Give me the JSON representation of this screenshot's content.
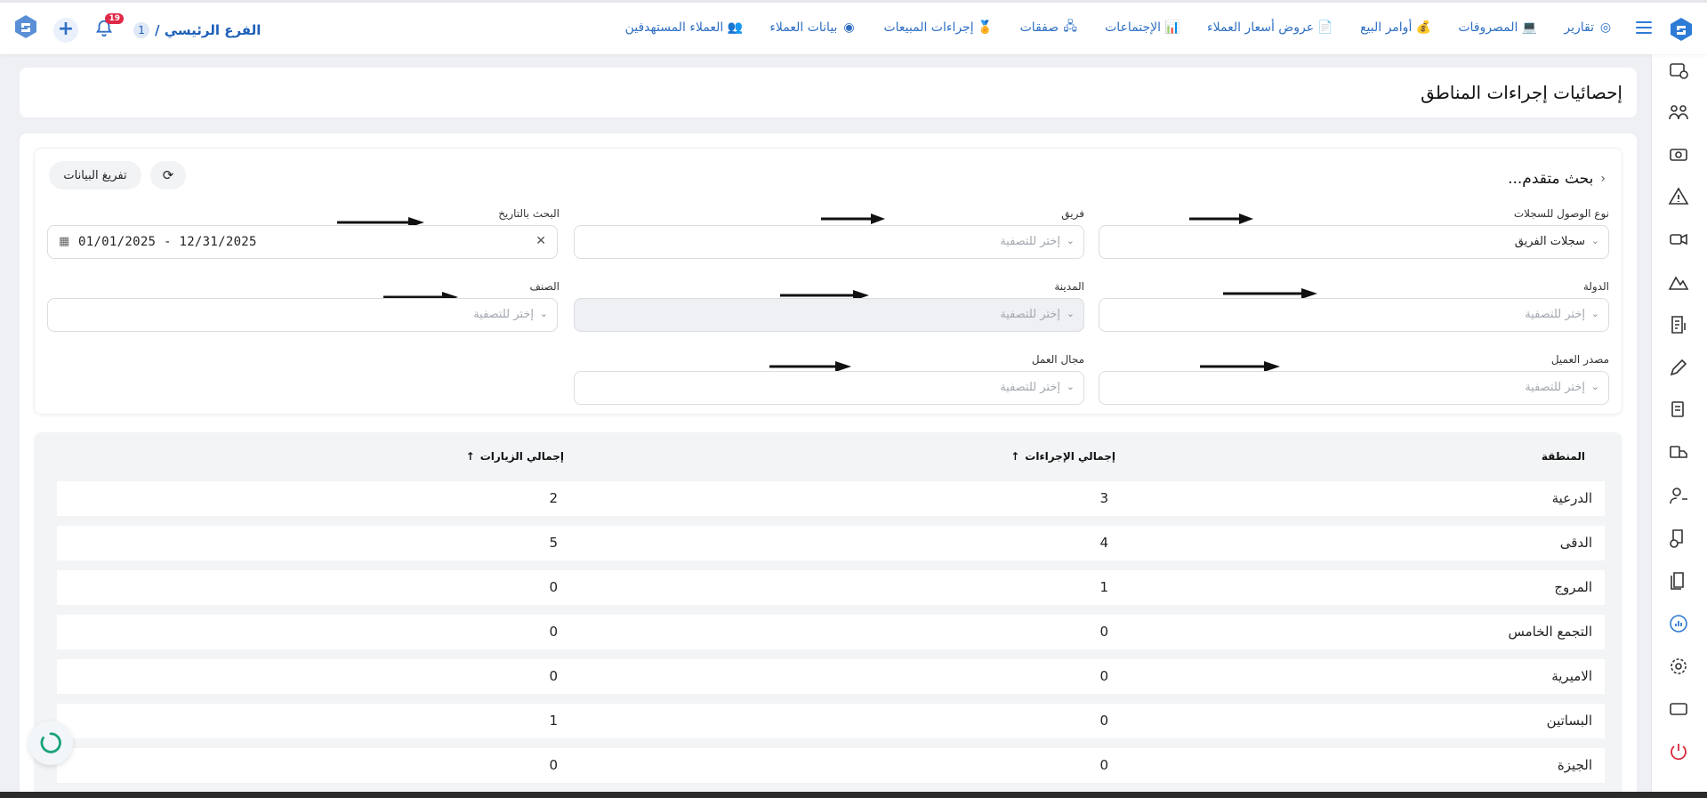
{
  "nav": {
    "items": [
      {
        "label": "العملاء المستهدفين",
        "icon": "target-users-icon"
      },
      {
        "label": "بيانات العملاء",
        "icon": "webcam-icon"
      },
      {
        "label": "إجراءات المبيعات",
        "icon": "award-icon"
      },
      {
        "label": "صفقات",
        "icon": "network-icon"
      },
      {
        "label": "الإجتماعات",
        "icon": "presentation-icon"
      },
      {
        "label": "عروض أسعار العملاء",
        "icon": "document-icon"
      },
      {
        "label": "أوامر البيع",
        "icon": "money-bag-icon"
      },
      {
        "label": "المصروفات",
        "icon": "laptop-icon"
      },
      {
        "label": "تقارير",
        "icon": "chart-ring-icon"
      }
    ],
    "branch": "الفرع الرئيسي /",
    "branch_count": "1",
    "notif_count": "19"
  },
  "page": {
    "title": "إحصائيات إجراءات المناطق"
  },
  "filters": {
    "advanced_search": "بحث متقدم...",
    "export_label": "تفريغ البيانات",
    "access_type_label": "نوع الوصول للسجلات",
    "access_type_value": "سجلات الفريق",
    "team_label": "فريق",
    "date_label": "البحث بالتاريخ",
    "date_value": "01/01/2025 - 12/31/2025",
    "country_label": "الدولة",
    "city_label": "المدينة",
    "category_label": "الصنف",
    "source_label": "مصدر العميل",
    "field_label": "مجال العمل",
    "placeholder": "إختر للتصفية"
  },
  "table": {
    "headers": {
      "region": "المنطقة",
      "actions": "إجمالي الإجراءات",
      "visits": "إجمالي الزيارات"
    },
    "rows": [
      {
        "region": "الدرعية",
        "actions": "3",
        "visits": "2"
      },
      {
        "region": "الدقى",
        "actions": "4",
        "visits": "5"
      },
      {
        "region": "المروج",
        "actions": "1",
        "visits": "0"
      },
      {
        "region": "التجمع الخامس",
        "actions": "0",
        "visits": "0"
      },
      {
        "region": "الاميرية",
        "actions": "0",
        "visits": "0"
      },
      {
        "region": "البساتين",
        "actions": "0",
        "visits": "1"
      },
      {
        "region": "الجيزة",
        "actions": "0",
        "visits": "0"
      }
    ]
  },
  "colors": {
    "accent": "#2e6fc4",
    "badge": "#e02847",
    "danger": "#d9283a"
  }
}
